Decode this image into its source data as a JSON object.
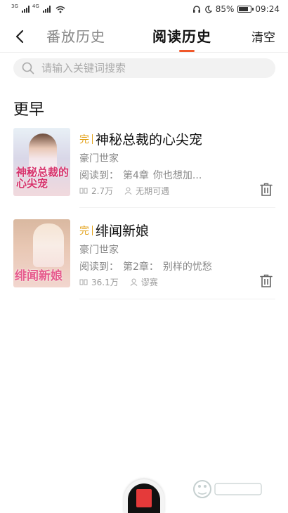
{
  "status_bar": {
    "sim1_label": "3G",
    "sim2_label": "4G",
    "battery_percent": "85%",
    "battery_level": 0.85,
    "time": "09:24"
  },
  "header": {
    "back_icon": "chevron-left-icon",
    "tabs": [
      {
        "label": "番放历史",
        "active": false
      },
      {
        "label": "阅读历史",
        "active": true
      }
    ],
    "clear_label": "清空",
    "accent_color": "#f0582b"
  },
  "search": {
    "placeholder": "请输入关键词搜索",
    "icon": "search-icon"
  },
  "section": {
    "title": "更早"
  },
  "books": [
    {
      "status_tag": "完",
      "title": "神秘总裁的心尖宠",
      "category": "豪门世家",
      "progress_label": "阅读到：",
      "chapter": "第4章",
      "chapter_title": "你也想加...",
      "views": "2.7万",
      "author": "无期可遇",
      "cover_text": "神秘总裁的心尖宠"
    },
    {
      "status_tag": "完",
      "title": "绯闻新娘",
      "category": "豪门世家",
      "progress_label": "阅读到：",
      "chapter": "第2章：",
      "chapter_title": "别样的忧愁",
      "views": "36.1万",
      "author": "谬赛",
      "cover_text": "绯闻新娘"
    }
  ],
  "colors": {
    "tag": "#e3a21a",
    "accent": "#f0582b"
  }
}
